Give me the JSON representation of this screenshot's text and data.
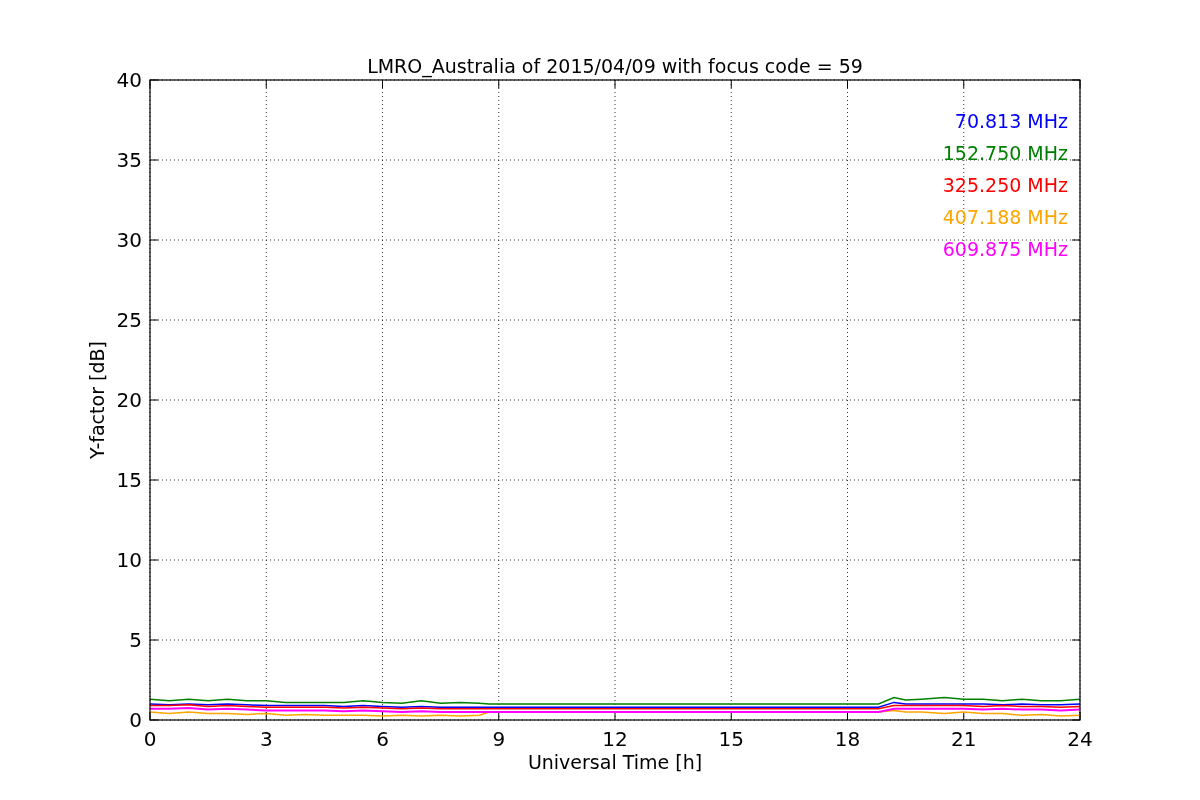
{
  "chart_data": {
    "type": "line",
    "title": "LMRO_Australia of 2015/04/09 with focus code = 59",
    "xlabel": "Universal Time [h]",
    "ylabel": "Y-factor [dB]",
    "x": [
      0,
      0.5,
      1,
      1.5,
      2,
      2.5,
      3,
      3.5,
      4,
      4.5,
      5,
      5.5,
      6,
      6.5,
      7,
      7.5,
      8,
      8.5,
      8.75,
      18.8,
      19.2,
      19.5,
      19.9,
      20.5,
      21,
      21.5,
      22,
      22.5,
      23,
      23.5,
      24
    ],
    "series": [
      {
        "name": "70.813 MHz",
        "color": "#0000ff",
        "values": [
          1.0,
          0.95,
          1.0,
          0.95,
          1.0,
          0.95,
          0.9,
          0.9,
          0.9,
          0.9,
          0.85,
          0.9,
          0.85,
          0.8,
          0.85,
          0.8,
          0.8,
          0.8,
          0.8,
          0.8,
          1.1,
          1.0,
          1.0,
          1.0,
          1.0,
          1.0,
          0.95,
          1.0,
          0.95,
          0.95,
          1.0
        ]
      },
      {
        "name": "152.750 MHz",
        "color": "#008000",
        "values": [
          1.3,
          1.2,
          1.3,
          1.2,
          1.3,
          1.2,
          1.2,
          1.1,
          1.1,
          1.1,
          1.1,
          1.2,
          1.1,
          1.05,
          1.2,
          1.05,
          1.1,
          1.05,
          1.0,
          1.0,
          1.4,
          1.25,
          1.3,
          1.4,
          1.3,
          1.3,
          1.2,
          1.3,
          1.2,
          1.2,
          1.3
        ]
      },
      {
        "name": "325.250 MHz",
        "color": "#ff0000",
        "values": [
          0.9,
          0.9,
          0.95,
          0.85,
          0.9,
          0.85,
          0.8,
          0.8,
          0.8,
          0.8,
          0.75,
          0.8,
          0.75,
          0.7,
          0.75,
          0.7,
          0.7,
          0.7,
          0.7,
          0.7,
          0.9,
          0.9,
          0.9,
          0.9,
          0.9,
          0.85,
          0.9,
          0.85,
          0.85,
          0.8,
          0.85
        ]
      },
      {
        "name": "407.188 MHz",
        "color": "#ffa500",
        "values": [
          0.5,
          0.4,
          0.5,
          0.4,
          0.4,
          0.35,
          0.4,
          0.3,
          0.35,
          0.3,
          0.3,
          0.3,
          0.25,
          0.3,
          0.25,
          0.3,
          0.25,
          0.3,
          0.5,
          0.5,
          0.6,
          0.5,
          0.5,
          0.4,
          0.5,
          0.4,
          0.4,
          0.3,
          0.35,
          0.25,
          0.3
        ]
      },
      {
        "name": "609.875 MHz",
        "color": "#ff00ff",
        "values": [
          0.7,
          0.7,
          0.75,
          0.65,
          0.7,
          0.65,
          0.6,
          0.6,
          0.6,
          0.6,
          0.55,
          0.6,
          0.55,
          0.5,
          0.55,
          0.5,
          0.5,
          0.5,
          0.5,
          0.5,
          0.7,
          0.7,
          0.7,
          0.7,
          0.7,
          0.65,
          0.7,
          0.65,
          0.65,
          0.6,
          0.65
        ]
      }
    ],
    "grid": true,
    "xlim": [
      0,
      24
    ],
    "ylim": [
      0,
      40
    ],
    "xticks": [
      0,
      3,
      6,
      9,
      12,
      15,
      18,
      21,
      24
    ],
    "yticks": [
      0,
      5,
      10,
      15,
      20,
      25,
      30,
      35,
      40
    ]
  }
}
